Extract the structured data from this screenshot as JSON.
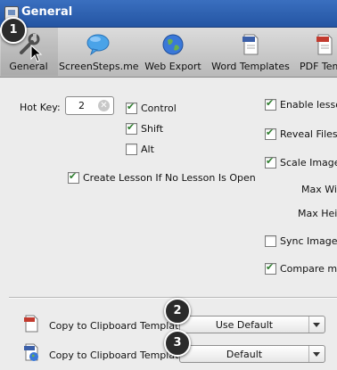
{
  "window": {
    "title": "General"
  },
  "toolbar": {
    "items": [
      {
        "label": "General",
        "icon": "wrench-icon"
      },
      {
        "label": "ScreenSteps.me",
        "icon": "speech-bubble-icon"
      },
      {
        "label": "Web Export",
        "icon": "globe-icon"
      },
      {
        "label": "Word Templates",
        "icon": "word-document-icon"
      },
      {
        "label": "PDF Tem",
        "icon": "pdf-document-icon"
      }
    ]
  },
  "hotkey": {
    "label": "Hot Key:",
    "value": "2",
    "control_label": "Control",
    "shift_label": "Shift",
    "alt_label": "Alt",
    "control_checked": true,
    "shift_checked": true,
    "alt_checked": false
  },
  "create_lesson": {
    "label": "Create Lesson If No Lesson Is Open",
    "checked": true
  },
  "right_options": {
    "enable_lesson": {
      "label": "Enable lesson",
      "checked": true
    },
    "reveal_files": {
      "label": "Reveal Files A",
      "checked": true
    },
    "scale_images": {
      "label": "Scale Images",
      "checked": true
    },
    "max_width": {
      "label": "Max Wid"
    },
    "max_height": {
      "label": "Max Heig"
    },
    "sync_image": {
      "label": "Sync Image M",
      "checked": false
    },
    "compare": {
      "label": "Compare mar",
      "checked": true
    }
  },
  "clipboard": {
    "pdf": {
      "label": "Copy to Clipboard Template:",
      "value": "Use Default"
    },
    "html": {
      "label": "Copy to Clipboard Template:",
      "value": "Default"
    }
  },
  "badges": [
    "1",
    "2",
    "3"
  ]
}
